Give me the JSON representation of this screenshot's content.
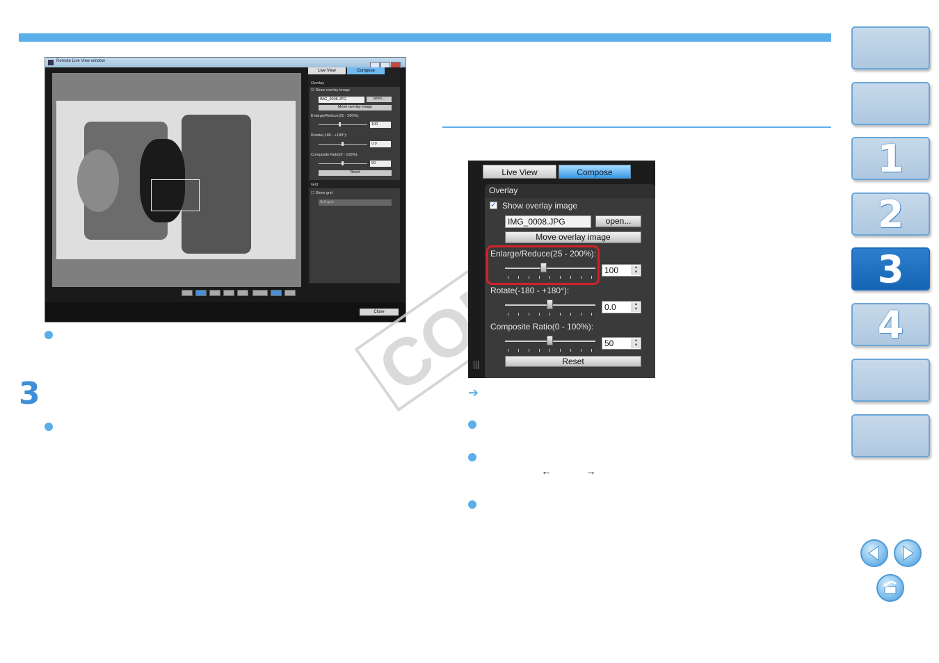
{
  "screenshot": {
    "window_title": "Remote Live View window",
    "tabs": [
      "Live View",
      "Compose"
    ],
    "overlay_header": "Overlay",
    "show_overlay_label": "Show overlay image",
    "file_name": "IMG_0008.JPG",
    "open_label": "open...",
    "move_overlay_label": "Move overlay image",
    "enlarge_label": "Enlarge/Reduce(25 - 200%):",
    "enlarge_value": "100",
    "rotate_label": "Rotate(-180 - +180°):",
    "rotate_value": "0.0",
    "composite_label": "Composite Ratio(0 - 100%):",
    "composite_value": "50",
    "reset_label": "Reset",
    "grid_header": "Grid",
    "show_grid_label": "Show grid",
    "grid_select": "3x3 grid",
    "close_label": "Close"
  },
  "zoom": {
    "tab_live_view": "Live View",
    "tab_compose": "Compose",
    "overlay_header": "Overlay",
    "show_overlay_label": "Show overlay image",
    "show_overlay_checked": true,
    "file_name": "IMG_0008.JPG",
    "open_label": "open...",
    "move_overlay_label": "Move overlay image",
    "enlarge_label": "Enlarge/Reduce(25 - 200%):",
    "enlarge_value": "100",
    "rotate_label": "Rotate(-180 - +180°):",
    "rotate_value": "0.0",
    "composite_label": "Composite Ratio(0 - 100%):",
    "composite_value": "50",
    "reset_label": "Reset"
  },
  "body": {
    "step_number": "3",
    "key_left": "←",
    "key_right": "→",
    "arrow_bullet": "➔"
  },
  "watermark": "COP",
  "nav": {
    "chapters": [
      "",
      "",
      "1",
      "2",
      "3",
      "4",
      "",
      ""
    ],
    "active_chapter": "3"
  },
  "colors": {
    "accent": "#5aaee9",
    "active_tab": "#1565b5",
    "highlight": "#d4202a"
  },
  "icons": [
    "prev-page-icon",
    "next-page-icon",
    "return-icon"
  ]
}
